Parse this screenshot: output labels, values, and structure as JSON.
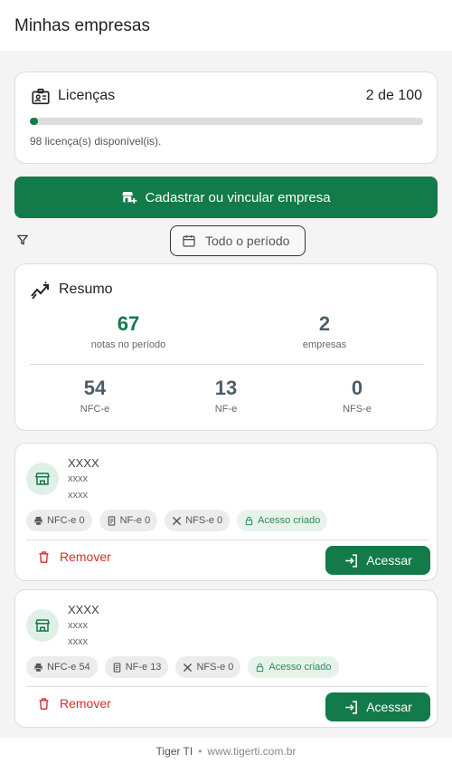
{
  "header": {
    "title": "Minhas empresas"
  },
  "licenses": {
    "label": "Licenças",
    "count_text": "2 de 100",
    "used": 2,
    "total": 100,
    "available_text": "98 licença(s) disponível(is)."
  },
  "cta": {
    "label": "Cadastrar ou vincular empresa"
  },
  "filter": {
    "period_label": "Todo o período"
  },
  "summary": {
    "label": "Resumo",
    "top": [
      {
        "value": "67",
        "label": "notas no período"
      },
      {
        "value": "2",
        "label": "empresas"
      }
    ],
    "bottom": [
      {
        "value": "54",
        "label": "NFC-e"
      },
      {
        "value": "13",
        "label": "NF-e"
      },
      {
        "value": "0",
        "label": "NFS-e"
      }
    ]
  },
  "companies": [
    {
      "name": "XXXX",
      "line1": "xxxx",
      "line2": "xxxx",
      "chips": [
        "NFC-e 0",
        "NF-e 0",
        "NFS-e 0"
      ],
      "status": "Acesso criado",
      "remove_label": "Remover",
      "access_label": "Acessar"
    },
    {
      "name": "XXXX",
      "line1": "xxxx",
      "line2": "xxxx",
      "chips": [
        "NFC-e 54",
        "NF-e 13",
        "NFS-e 0"
      ],
      "status": "Acesso criado",
      "remove_label": "Remover",
      "access_label": "Acessar"
    }
  ],
  "footer": {
    "brand": "Tiger TI",
    "separator": "•",
    "site": "www.tigerti.com.br"
  },
  "colors": {
    "primary": "#137a4a",
    "danger": "#d32f2f",
    "highlight_number": "#137a4a",
    "muted_number": "#4a5e6a"
  },
  "icons": [
    "license-card-icon",
    "store-add-icon",
    "filter-icon",
    "calendar-icon",
    "trend-icon",
    "store-icon",
    "printer-icon",
    "document-icon",
    "tools-icon",
    "lock-icon",
    "trash-icon",
    "login-icon"
  ]
}
